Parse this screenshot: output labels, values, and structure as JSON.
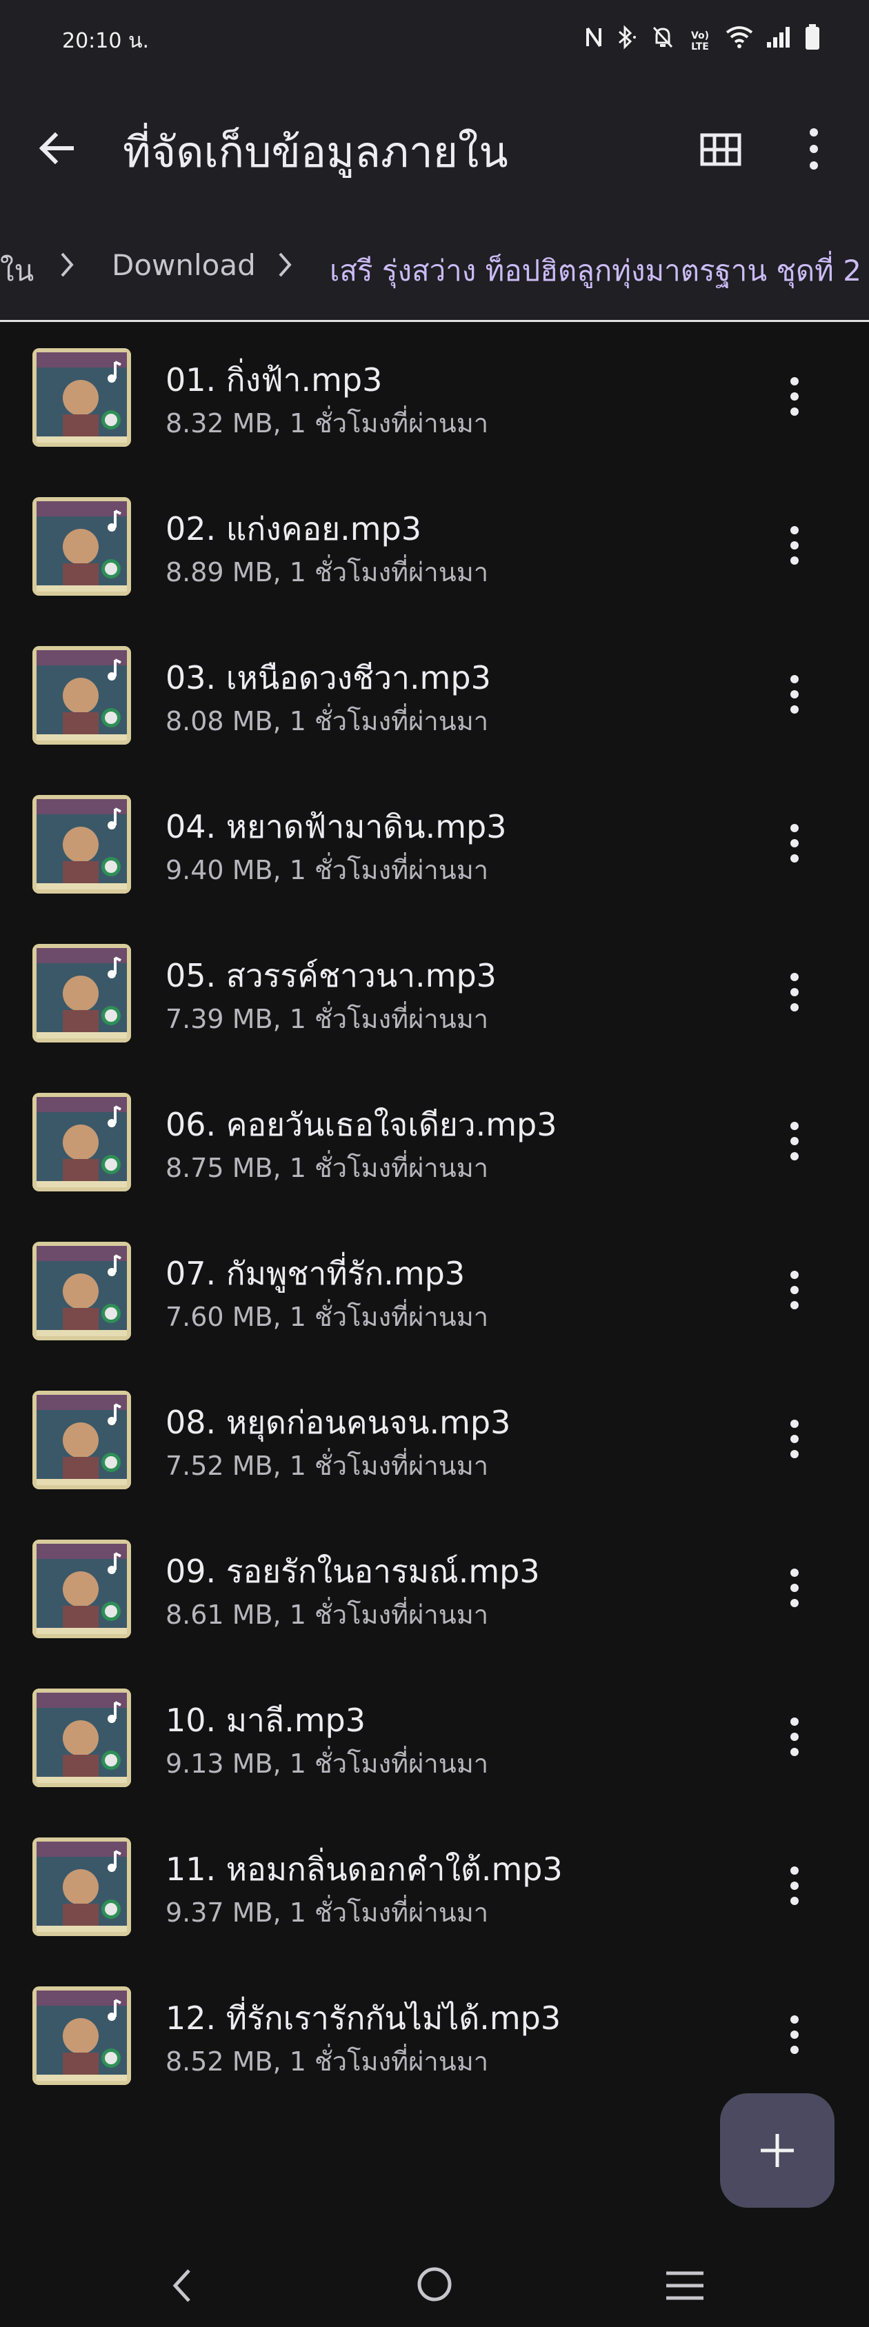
{
  "status_bar": {
    "time": "20:10 น.",
    "icons": [
      "nfc-icon",
      "bluetooth-icon",
      "mute-icon",
      "volte-icon",
      "wifi-icon",
      "signal-icon",
      "battery-icon"
    ],
    "volte_label": "Vo) LTE"
  },
  "app_bar": {
    "title": "ที่จัดเก็บข้อมูลภายใน",
    "icons": [
      "back-arrow-icon",
      "grid-view-icon",
      "more-vert-icon"
    ]
  },
  "breadcrumb": {
    "items": [
      "ใน",
      "Download",
      "เสรี รุ่งสว่าง ท็อปฮิตลูกทุ่งมาตรฐาน ชุดที่ 2"
    ]
  },
  "files": [
    {
      "name": "01. กิ่งฟ้า.mp3",
      "meta": "8.32 MB, 1 ชั่วโมงที่ผ่านมา"
    },
    {
      "name": "02. แก่งคอย.mp3",
      "meta": "8.89 MB, 1 ชั่วโมงที่ผ่านมา"
    },
    {
      "name": "03. เหนือดวงชีวา.mp3",
      "meta": "8.08 MB, 1 ชั่วโมงที่ผ่านมา"
    },
    {
      "name": "04. หยาดฟ้ามาดิน.mp3",
      "meta": "9.40 MB, 1 ชั่วโมงที่ผ่านมา"
    },
    {
      "name": "05. สวรรค์ชาวนา.mp3",
      "meta": "7.39 MB, 1 ชั่วโมงที่ผ่านมา"
    },
    {
      "name": "06. คอยวันเธอใจเดียว.mp3",
      "meta": "8.75 MB, 1 ชั่วโมงที่ผ่านมา"
    },
    {
      "name": "07. กัมพูชาที่รัก.mp3",
      "meta": "7.60 MB, 1 ชั่วโมงที่ผ่านมา"
    },
    {
      "name": "08. หยุดก่อนคนจน.mp3",
      "meta": "7.52 MB, 1 ชั่วโมงที่ผ่านมา"
    },
    {
      "name": "09. รอยรักในอารมณ์.mp3",
      "meta": "8.61 MB, 1 ชั่วโมงที่ผ่านมา"
    },
    {
      "name": "10. มาลี.mp3",
      "meta": "9.13 MB, 1 ชั่วโมงที่ผ่านมา"
    },
    {
      "name": "11. หอมกลิ่นดอกคำใต้.mp3",
      "meta": "9.37 MB, 1 ชั่วโมงที่ผ่านมา"
    },
    {
      "name": "12. ที่รักเรารักกันไม่ได้.mp3",
      "meta": "8.52 MB, 1 ชั่วโมงที่ผ่านมา"
    }
  ],
  "fab": {
    "icon": "add-icon"
  },
  "nav_bar": {
    "icons": [
      "nav-back-icon",
      "nav-home-icon",
      "nav-recents-icon"
    ]
  },
  "colors": {
    "background": "#121212",
    "surface": "#1f1f24",
    "primary_text": "#ececf1",
    "secondary_text": "#b7b6bd",
    "breadcrumb_active": "#cbbbf5",
    "fab": "#4b4a60"
  }
}
